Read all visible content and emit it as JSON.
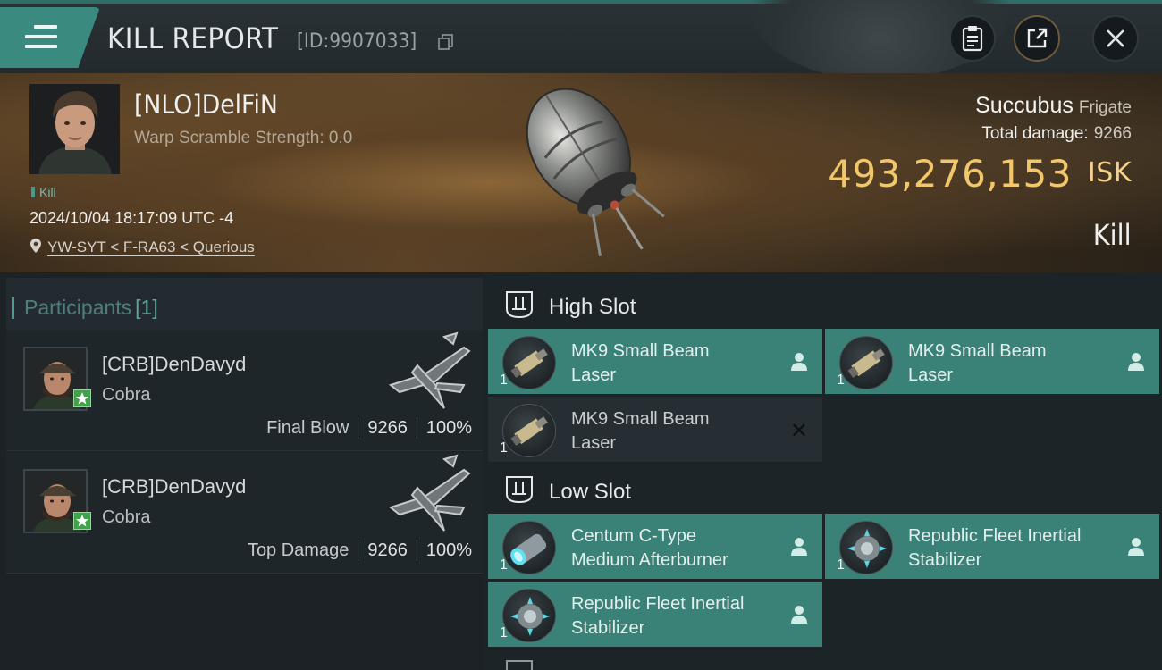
{
  "header": {
    "title": "KILL REPORT",
    "kill_id": "[ID:9907033]"
  },
  "victim": {
    "name": "[NLO]DelFiN",
    "warp_scramble": "Warp Scramble Strength: 0.0",
    "kill_tag": "Kill",
    "datetime": "2024/10/04 18:17:09 UTC -4",
    "location": "YW-SYT < F-RA63 < Querious",
    "ship_name": "Succubus",
    "ship_class": "Frigate",
    "total_damage_label": "Total damage:",
    "total_damage": "9266",
    "isk_value": "493,276,153",
    "isk_unit": "ISK",
    "result": "Kill"
  },
  "participants": {
    "label": "Participants",
    "count": "[1]",
    "rows": [
      {
        "name": "[CRB]DenDavyd",
        "ship": "Cobra",
        "role": "Final Blow",
        "damage": "9266",
        "percent": "100%"
      },
      {
        "name": "[CRB]DenDavyd",
        "ship": "Cobra",
        "role": "Top Damage",
        "damage": "9266",
        "percent": "100%"
      }
    ]
  },
  "fitting": {
    "high_slot": {
      "label": "High Slot",
      "modules": [
        {
          "name_line1": "MK9 Small Beam",
          "name_line2": "Laser",
          "qty": "1"
        },
        {
          "name_line1": "MK9 Small Beam",
          "name_line2": "Laser",
          "qty": "1"
        },
        {
          "name_line1": "MK9 Small Beam",
          "name_line2": "Laser",
          "qty": "1"
        }
      ]
    },
    "low_slot": {
      "label": "Low Slot",
      "modules": [
        {
          "name_line1": "Centum C-Type",
          "name_line2": "Medium Afterburner",
          "qty": "1"
        },
        {
          "name_line1": "Republic Fleet Inertial",
          "name_line2": "Stabilizer",
          "qty": "1"
        },
        {
          "name_line1": "Republic Fleet Inertial",
          "name_line2": "Stabilizer",
          "qty": "1"
        }
      ]
    }
  },
  "colors": {
    "accent_teal": "#3a8178",
    "isk_gold": "#f2c76a",
    "panel_dark": "#1c2226"
  }
}
